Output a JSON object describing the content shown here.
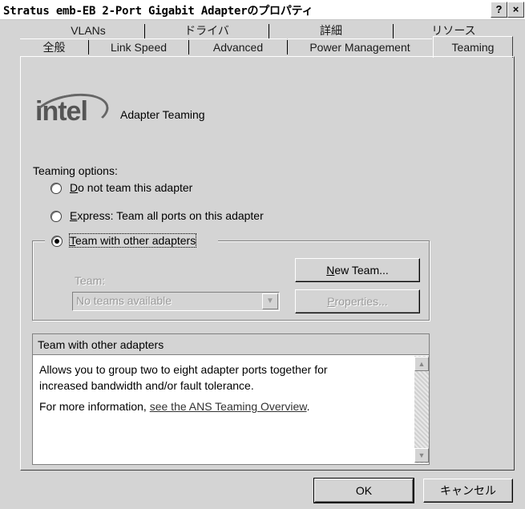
{
  "window": {
    "title": "Stratus emb-EB 2-Port Gigabit Adapterのプロパティ",
    "help_label": "?",
    "close_label": "×"
  },
  "tabs": {
    "row1": [
      "VLANs",
      "ドライバ",
      "詳細",
      "リソース"
    ],
    "row2": [
      "全般",
      "Link Speed",
      "Advanced",
      "Power Management"
    ],
    "active": "Teaming"
  },
  "header": {
    "logo_text": "intel",
    "section_title": "Adapter Teaming"
  },
  "options": {
    "title": "Teaming options:",
    "opt1_mn": "D",
    "opt1_rest": "o not team this adapter",
    "opt2_mn": "E",
    "opt2_rest": "xpress: Team all ports on this adapter",
    "opt3_mn": "T",
    "opt3_rest": "eam with other adapters",
    "selected": 3
  },
  "team_group": {
    "team_label": "Team:",
    "team_value": "No teams available",
    "new_team_mn": "N",
    "new_team_rest": "ew Team...",
    "properties_mn": "P",
    "properties_rest": "roperties..."
  },
  "info": {
    "header": "Team with other adapters",
    "line1": "Allows you to group two to eight adapter ports together for",
    "line2": "increased bandwidth and/or fault tolerance.",
    "more_prefix": "For more information, ",
    "link_text": "see the ANS Teaming Overview",
    "more_suffix": "."
  },
  "footer": {
    "ok_label": "OK",
    "cancel_label": "キャンセル"
  }
}
